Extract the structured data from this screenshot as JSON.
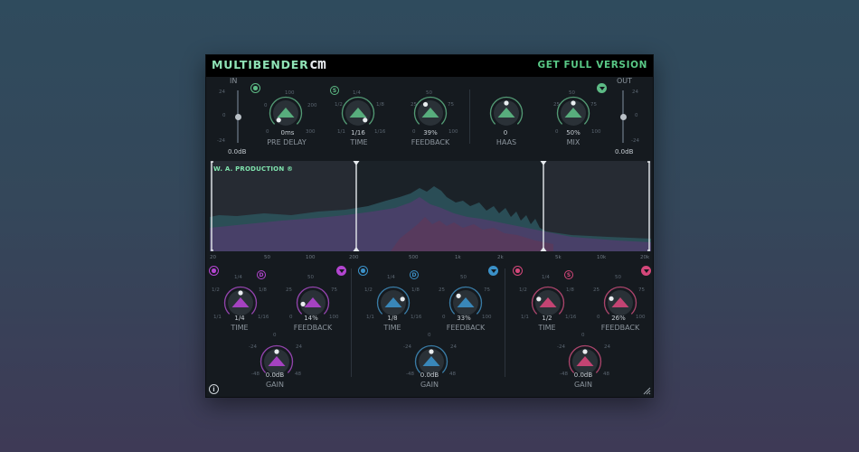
{
  "header": {
    "brand": "MULTIBENDER",
    "brand_suffix": "cm",
    "get_full_label": "GET FULL VERSION"
  },
  "colors": {
    "green": "#5dbb85",
    "purple": "#b345d0",
    "blue": "#3b91c8",
    "pink": "#d4477a"
  },
  "input": {
    "label": "IN",
    "scale_top": "24",
    "scale_mid": "0",
    "scale_bot": "-24",
    "value": "0.0dB",
    "level": 0.5
  },
  "output": {
    "label": "OUT",
    "scale_top": "24",
    "scale_mid": "0",
    "scale_bot": "-24",
    "value": "0.0dB",
    "level": 0.5
  },
  "global": {
    "pre_delay": {
      "label": "PRE DELAY",
      "value": "0ms",
      "ticks": [
        "0",
        "100",
        "200",
        "300"
      ],
      "amount": 0.0
    },
    "time": {
      "label": "TIME",
      "value": "1/16",
      "ticks": [
        "1/1",
        "1/2",
        "1/4",
        "1/8",
        "1/16"
      ],
      "badge": "S",
      "amount": 1.0
    },
    "feedback": {
      "label": "FEEDBACK",
      "value": "39%",
      "ticks": [
        "0",
        "25",
        "50",
        "75",
        "100"
      ],
      "amount": 0.39
    },
    "haas": {
      "label": "HAAS",
      "value": "0",
      "amount": 0.5
    },
    "mix": {
      "label": "MIX",
      "value": "50%",
      "ticks": [
        "0",
        "25",
        "50",
        "75",
        "100"
      ],
      "amount": 0.5
    }
  },
  "display": {
    "watermark": "W. A. PRODUCTION ®"
  },
  "freq_labels": [
    "20",
    "50",
    "100",
    "200",
    "500",
    "1k",
    "2k",
    "5k",
    "10k",
    "20k"
  ],
  "bands": [
    {
      "color": "#b345d0",
      "badge": "D",
      "time": {
        "label": "TIME",
        "value": "1/4",
        "ticks": [
          "1/1",
          "1/2",
          "1/4",
          "1/8",
          "1/16"
        ],
        "amount": 0.5
      },
      "feedback": {
        "label": "FEEDBACK",
        "value": "14%",
        "ticks": [
          "0",
          "25",
          "50",
          "75",
          "100"
        ],
        "amount": 0.14
      },
      "gain": {
        "label": "GAIN",
        "value": "0.0dB",
        "ticks": [
          "-48",
          "-24",
          "0",
          "24",
          "48"
        ],
        "amount": 0.5
      }
    },
    {
      "color": "#3b91c8",
      "badge": "D",
      "time": {
        "label": "TIME",
        "value": "1/8",
        "ticks": [
          "1/1",
          "1/2",
          "1/4",
          "1/8",
          "1/16"
        ],
        "amount": 0.75
      },
      "feedback": {
        "label": "FEEDBACK",
        "value": "33%",
        "ticks": [
          "0",
          "25",
          "50",
          "75",
          "100"
        ],
        "amount": 0.33
      },
      "gain": {
        "label": "GAIN",
        "value": "0.0dB",
        "ticks": [
          "-48",
          "-24",
          "0",
          "24",
          "48"
        ],
        "amount": 0.5
      }
    },
    {
      "color": "#d4477a",
      "badge": "S",
      "time": {
        "label": "TIME",
        "value": "1/2",
        "ticks": [
          "1/1",
          "1/2",
          "1/4",
          "1/8",
          "1/16"
        ],
        "amount": 0.25
      },
      "feedback": {
        "label": "FEEDBACK",
        "value": "26%",
        "ticks": [
          "0",
          "25",
          "50",
          "75",
          "100"
        ],
        "amount": 0.26
      },
      "gain": {
        "label": "GAIN",
        "value": "0.0dB",
        "ticks": [
          "-48",
          "-24",
          "0",
          "24",
          "48"
        ],
        "amount": 0.5
      }
    }
  ]
}
